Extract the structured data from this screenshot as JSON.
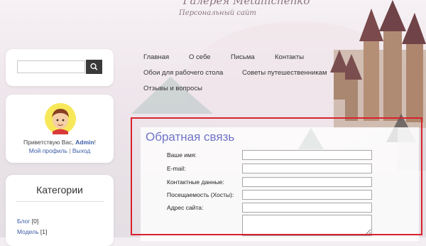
{
  "site": {
    "title": "Галерея Metallichenko",
    "subtitle": "Персональный сайт"
  },
  "search": {
    "placeholder": "",
    "button_icon": "search-icon"
  },
  "profile": {
    "greeting": "Приветствую Вас,",
    "username": "Admin",
    "my_profile": "Мой профиль",
    "separator": "|",
    "logout": "Выход",
    "avatar_icon": "boy-avatar-icon"
  },
  "categories": {
    "title": "Категории",
    "items": [
      {
        "name": "Блог",
        "count": "[0]"
      },
      {
        "name": "Модель",
        "count": "[1]"
      }
    ]
  },
  "nav": {
    "items": [
      "Главная",
      "О себе",
      "Письма",
      "Контакты",
      "Обои для рабочего стола",
      "Советы путешественникам",
      "Отзывы и вопросы"
    ]
  },
  "feedback": {
    "title": "Обратная связь",
    "fields": [
      {
        "label": "Ваше имя:",
        "value": ""
      },
      {
        "label": "E-mail:",
        "value": ""
      },
      {
        "label": "Контактные данные:",
        "value": ""
      },
      {
        "label": "Посещаемость (Хосты):",
        "value": ""
      },
      {
        "label": "Адрес сайта:",
        "value": ""
      },
      {
        "label": "",
        "value": ""
      }
    ]
  },
  "colors": {
    "highlight_frame": "#d8222d",
    "link": "#3a5ba8",
    "feedback_title": "#6e73c6"
  }
}
